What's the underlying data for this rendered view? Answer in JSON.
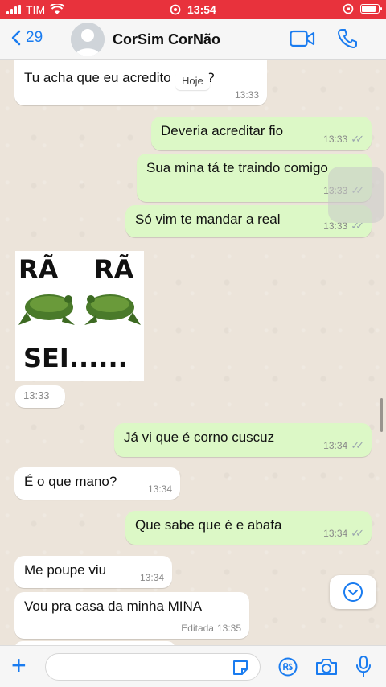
{
  "status_bar": {
    "carrier": "TIM",
    "time": "13:54"
  },
  "header": {
    "back_count": "29",
    "contact_name": "CorSim CorNão"
  },
  "chat": {
    "date_label": "Hoje",
    "messages": [
      {
        "text": "Tu acha que eu acredito nisso?",
        "time": "13:33"
      },
      {
        "text": "Deveria acreditar fio",
        "time": "13:33"
      },
      {
        "text": "Sua mina tá te traindo comigo",
        "time": "13:33"
      },
      {
        "text": "Só vim te mandar a real",
        "time": "13:33"
      },
      {
        "text": "Já vi que é corno cuscuz",
        "time": "13:34"
      },
      {
        "text": "É o que mano?",
        "time": "13:34"
      },
      {
        "text": "Que sabe que é e abafa",
        "time": "13:34"
      },
      {
        "text": "Me poupe viu",
        "time": "13:34"
      },
      {
        "text": "Vou pra casa da minha MINA",
        "time": "13:35",
        "edited_label": "Editada"
      }
    ],
    "sticker": {
      "word_left": "RÃ",
      "word_right": "RÃ",
      "word_bottom": "SEI......",
      "time": "13:33"
    }
  },
  "colors": {
    "outgoing": "#dcf8c6",
    "incoming": "#ffffff",
    "accent": "#1a7cf0",
    "status_bar": "#e8323c"
  },
  "icons": [
    "wifi-icon",
    "alarm-icon",
    "battery-icon",
    "back-chevron-icon",
    "video-call-icon",
    "phone-icon",
    "plus-icon",
    "sticker-icon",
    "payment-icon",
    "camera-icon",
    "microphone-icon",
    "chevron-down-icon"
  ]
}
